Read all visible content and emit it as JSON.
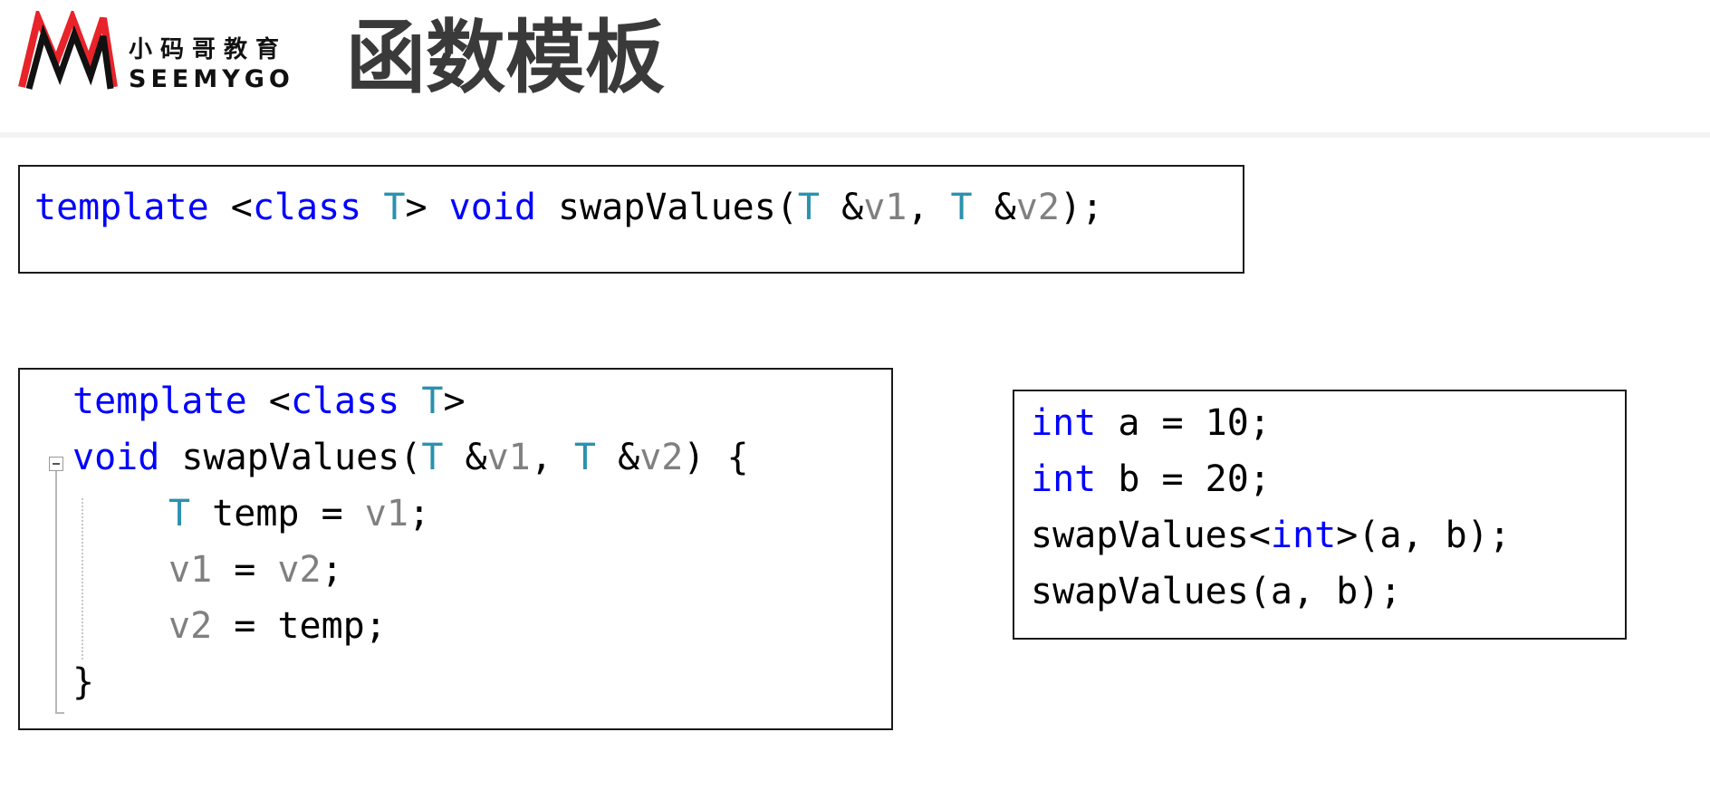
{
  "header": {
    "logo": {
      "cn_text": "小码哥教育",
      "en_text": "SEEMYGO"
    },
    "title": "函数模板"
  },
  "colors": {
    "keyword": "#0000ff",
    "type": "#2b91af",
    "param": "#808080",
    "text": "#000000",
    "logo_red": "#e8232a"
  },
  "decl_box": {
    "line1": {
      "t1": "template",
      "t2": " <",
      "t3": "class",
      "t4": " ",
      "t5": "T",
      "t6": "> ",
      "t7": "void",
      "t8": " swapValues(",
      "t9": "T",
      "t10": " &",
      "t11": "v1",
      "t12": ", ",
      "t13": "T",
      "t14": " &",
      "t15": "v2",
      "t16": ");"
    }
  },
  "def_box": {
    "line1": {
      "t1": "template",
      "t2": " <",
      "t3": "class",
      "t4": " ",
      "t5": "T",
      "t6": ">"
    },
    "line2": {
      "t1": "void",
      "t2": " swapValues(",
      "t3": "T",
      "t4": " &",
      "t5": "v1",
      "t6": ", ",
      "t7": "T",
      "t8": " &",
      "t9": "v2",
      "t10": ") {"
    },
    "line3": {
      "t1": "T",
      "t2": " temp = ",
      "t3": "v1",
      "t4": ";"
    },
    "line4": {
      "t1": "v1",
      "t2": " = ",
      "t3": "v2",
      "t4": ";"
    },
    "line5": {
      "t1": "v2",
      "t2": " = temp;"
    },
    "line6": {
      "t1": "}"
    }
  },
  "usage_box": {
    "line1": {
      "t1": "int",
      "t2": " a = 10;"
    },
    "line2": {
      "t1": "int",
      "t2": " b = 20;"
    },
    "line3": {
      "t1": "swapValues<",
      "t2": "int",
      "t3": ">(a, b);"
    },
    "line4": {
      "t1": "swapValues(a, b);"
    }
  }
}
